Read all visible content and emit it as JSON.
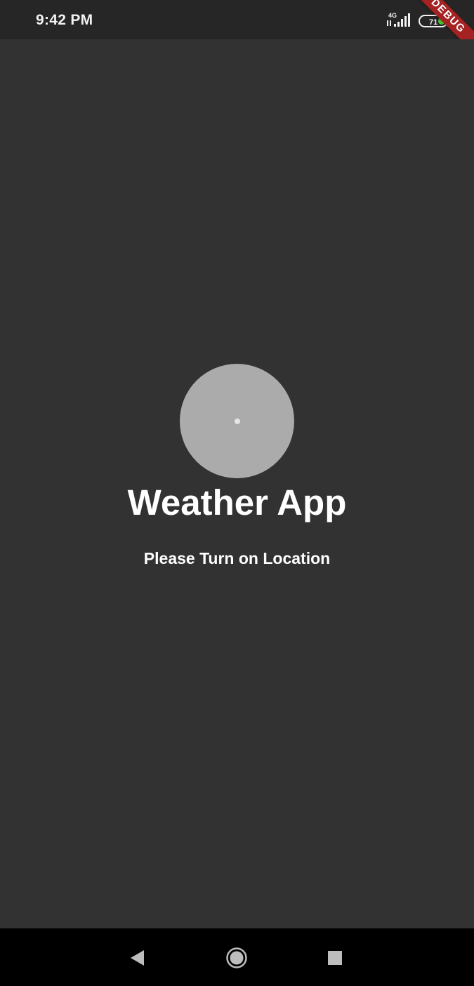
{
  "status_bar": {
    "time": "9:42 PM",
    "network_type": "4G",
    "battery_level": "71",
    "signal_icon": "cellular-signal-icon",
    "battery_icon": "battery-icon"
  },
  "debug_banner": {
    "label": "DEBUG",
    "color": "#a52222"
  },
  "main": {
    "logo_icon": "weather-logo-placeholder",
    "title": "Weather App",
    "message": "Please Turn on Location",
    "background_color": "#323232",
    "logo_color": "#ababab"
  },
  "navigation_bar": {
    "back_icon": "back-triangle-icon",
    "home_icon": "home-circle-icon",
    "recents_icon": "recents-square-icon"
  }
}
